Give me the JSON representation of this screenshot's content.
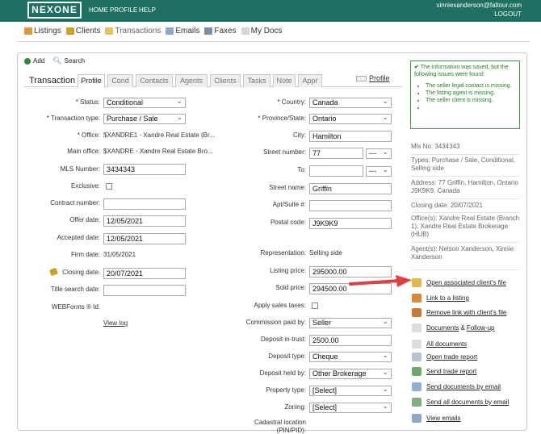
{
  "app": {
    "logo": "NEXONE",
    "nav": [
      "HOME",
      "PROFILE",
      "HELP"
    ],
    "user_email": "xinniexanderson@faltour.com",
    "logout": "LOGOUT"
  },
  "subnav": {
    "items": [
      "Listings",
      "Clients",
      "Transactions",
      "Emails",
      "Faxes",
      "My Docs"
    ]
  },
  "actions": {
    "add": "Add",
    "search": "Search"
  },
  "tabs": {
    "title": "Transaction",
    "items": [
      "Profile",
      "Cond",
      "Contacts",
      "Agents",
      "Clients",
      "Tasks",
      "Note",
      "Appr"
    ],
    "profile_link": "Profile"
  },
  "left": {
    "status": {
      "label": "* Status:",
      "value": "Conditional"
    },
    "type": {
      "label": "* Transaction type:",
      "value": "Purchase / Sale"
    },
    "office": {
      "label": "* Office:",
      "value": "$XANDRE1 - Xandre Real Estate (Br..."
    },
    "main_office": {
      "label": "Main office:",
      "value": "$XANDRE - Xandre Real Estate Bro..."
    },
    "mls": {
      "label": "MLS Number:",
      "value": "3434343"
    },
    "exclusive": {
      "label": "Exclusive:"
    },
    "contract": {
      "label": "Contract number:",
      "value": ""
    },
    "offer": {
      "label": "Offer date:",
      "value": "12/05/2021"
    },
    "accepted": {
      "label": "Accepted date:",
      "value": "12/05/2021"
    },
    "firm": {
      "label": "Firm date:",
      "value": "31/05/2021"
    },
    "closing": {
      "label": "Closing date:",
      "value": "20/07/2021"
    },
    "title_search": {
      "label": "Title search date:",
      "value": ""
    },
    "webforms": {
      "label": "WEBForms ® Id:"
    },
    "view_log": "View log"
  },
  "right": {
    "country": {
      "label": "* Country:",
      "value": "Canada"
    },
    "province": {
      "label": "* Province/State:",
      "value": "Ontario"
    },
    "city": {
      "label": "City:",
      "value": "Hamilton"
    },
    "street_number": {
      "label": "Street number:",
      "value": "77",
      "suffix": "---"
    },
    "to": {
      "label": "To:",
      "value": "",
      "suffix": "---"
    },
    "street_name": {
      "label": "Street name:",
      "value": "Griffin"
    },
    "apt": {
      "label": "Apt/Suite #:",
      "value": ""
    },
    "postal": {
      "label": "Postal code:",
      "value": "J9K9K9"
    },
    "representation": {
      "label": "Representation:",
      "value": "Selling side"
    },
    "listing_price": {
      "label": "Listing price:",
      "value": "295000.00"
    },
    "sold_price": {
      "label": "Sold price:",
      "value": "294500.00"
    },
    "apply_taxes": {
      "label": "Apply sales taxes:"
    },
    "commission": {
      "label": "Commission paid by:",
      "value": "Seller"
    },
    "deposit": {
      "label": "Deposit in-trust:",
      "value": "2500.00"
    },
    "deposit_type": {
      "label": "Deposit type:",
      "value": "Cheque"
    },
    "deposit_held": {
      "label": "Deposit held by:",
      "value": "Other Brokerage"
    },
    "property_type": {
      "label": "Property type:",
      "value": "[Select]"
    },
    "zoning": {
      "label": "Zoning:",
      "value": "[Select]"
    },
    "cadastral": {
      "label": "Cadastral location",
      "label2": "(PIN/PID):"
    }
  },
  "message": {
    "text": "The information was saved, but the following issues were found:",
    "issues": [
      "The seller legal contact is missing.",
      "The listing agent is missing.",
      "The seller client is missing.",
      ""
    ]
  },
  "summary": {
    "mls": "Mls No:  3434343",
    "types": "Types:  Purchase / Sale, Conditional, Selling side",
    "address": "Address:  77 Griffin, Hamilton, Ontario J9K9K9, Canada",
    "closing": "Closing date:  20/07/2021",
    "offices": "Office(s):  Xandre Real Estate (Branch 1), Xandre Real Estate Brokerage (HUB)",
    "agents": "Agent(s):  Nelson Xanderson, Xinnie Xanderson"
  },
  "links": {
    "open_client": "Open associated client's file",
    "link_listing": "Link to a listing",
    "remove_link": "Remove link with client's file",
    "documents": "Documents",
    "amp": "&",
    "follow_up": "Follow-up",
    "all_documents": "All documents",
    "open_trade": "Open trade report",
    "send_trade": "Send trade report",
    "send_docs_email": "Send documents by email",
    "send_all_docs_email": "Send all documents by email",
    "view_emails": "View emails"
  },
  "colors": {
    "header": "#1f6f63",
    "message_green": "#2a7a2a",
    "arrow": "#e04040"
  }
}
